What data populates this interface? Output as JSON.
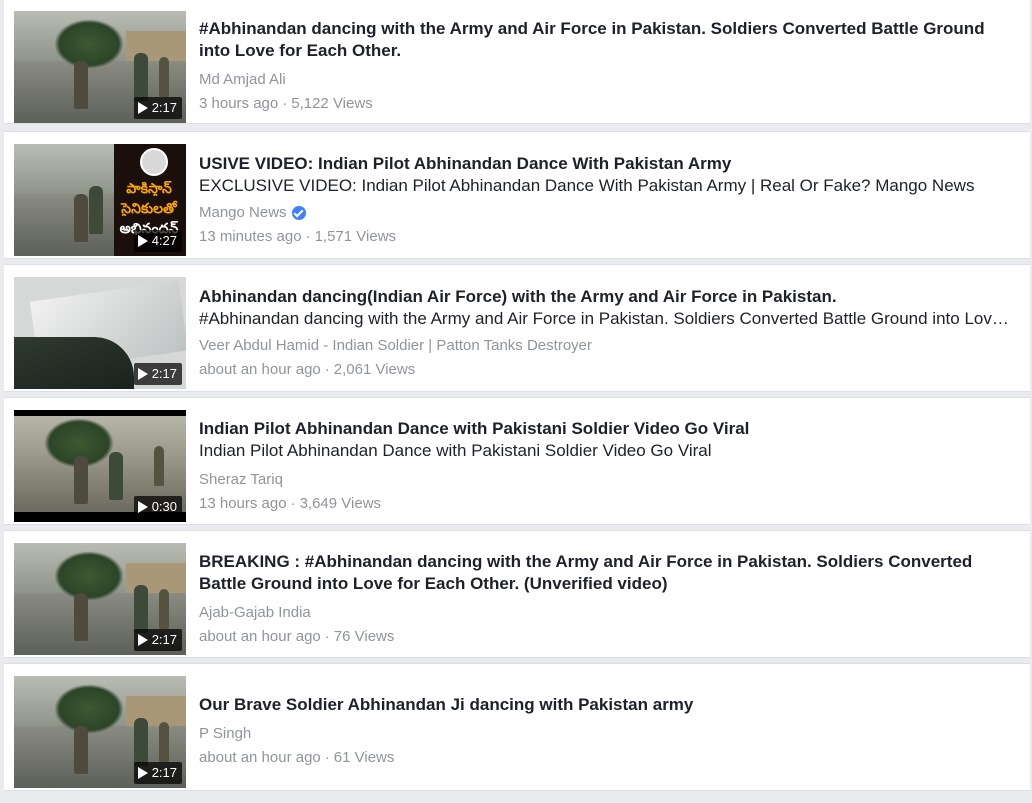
{
  "videos": [
    {
      "title": "#Abhinandan dancing with the Army and Air Force in Pakistan. Soldiers Converted Battle Ground into Love for Each Other.",
      "description": "",
      "channel": "Md Amjad Ali",
      "verified": false,
      "time": "3 hours ago",
      "views": "5,122 Views",
      "duration": "2:17"
    },
    {
      "title": "USIVE VIDEO: Indian Pilot Abhinandan Dance With Pakistan Army",
      "description": "EXCLUSIVE VIDEO: Indian Pilot Abhinandan Dance With Pakistan Army | Real Or Fake? Mango News",
      "channel": "Mango News",
      "verified": true,
      "time": "13 minutes ago",
      "views": "1,571 Views",
      "duration": "4:27",
      "thumb_text": [
        "పాకిస్తాన్",
        "సైనికులతో",
        "అభినందన్"
      ]
    },
    {
      "title": "Abhinandan dancing(Indian Air Force) with the Army and Air Force in Pakistan.",
      "description": "#Abhinandan dancing with the Army and Air Force in Pakistan. Soldiers Converted Battle Ground into Love for Each Other.",
      "channel": "Veer Abdul Hamid - Indian Soldier | Patton Tanks Destroyer",
      "verified": false,
      "time": "about an hour ago",
      "views": "2,061 Views",
      "duration": "2:17"
    },
    {
      "title": "Indian Pilot Abhinandan Dance with Pakistani Soldier Video Go Viral",
      "description": "Indian Pilot Abhinandan Dance with Pakistani Soldier Video Go Viral",
      "channel": "Sheraz Tariq",
      "verified": false,
      "time": "13 hours ago",
      "views": "3,649 Views",
      "duration": "0:30"
    },
    {
      "title": "BREAKING : #Abhinandan dancing with the Army and Air Force in Pakistan. Soldiers Converted Battle Ground into Love for Each Other. (Unverified video)",
      "description": "",
      "channel": "Ajab-Gajab India",
      "verified": false,
      "time": "about an hour ago",
      "views": "76 Views",
      "duration": "2:17"
    },
    {
      "title": "Our Brave Soldier Abhinandan Ji dancing with Pakistan army",
      "description": "",
      "channel": "P Singh",
      "verified": false,
      "time": "about an hour ago",
      "views": "61 Views",
      "duration": "2:17"
    }
  ],
  "separator": "·"
}
